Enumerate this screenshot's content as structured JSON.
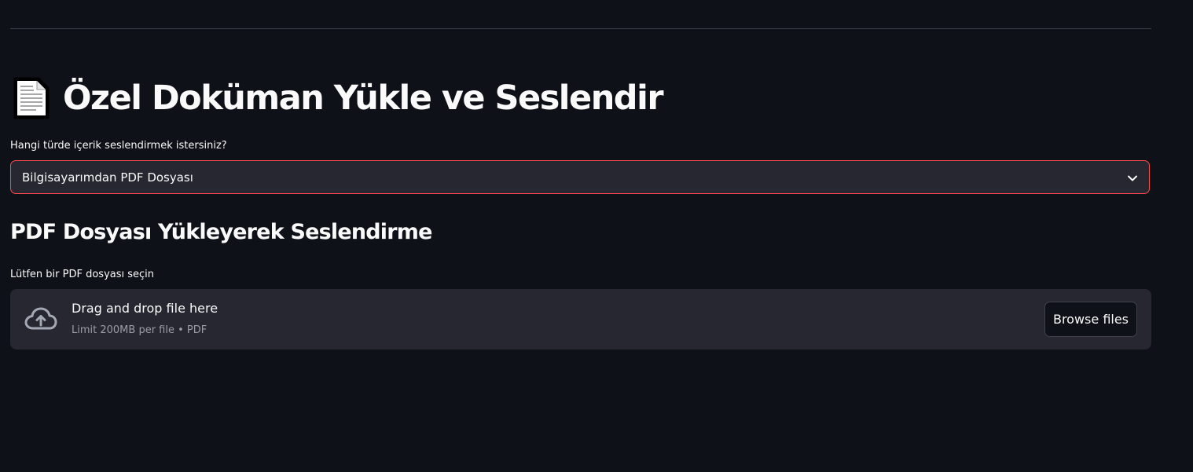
{
  "page": {
    "title": "Özel Doküman Yükle ve Seslendir",
    "title_icon": "page-facing-up-icon"
  },
  "content_type": {
    "label": "Hangi türde içerik seslendirmek istersiniz?",
    "selected": "Bilgisayarımdan PDF Dosyası",
    "accent_color": "#ff4b4b"
  },
  "section": {
    "title": "PDF Dosyası Yükleyerek Seslendirme"
  },
  "uploader": {
    "label": "Lütfen bir PDF dosyası seçin",
    "drop_text": "Drag and drop file here",
    "limit_text": "Limit 200MB per file • PDF",
    "browse_label": "Browse files",
    "icon": "cloud-upload-icon"
  },
  "colors": {
    "background": "#0e1117",
    "surface": "#262730",
    "text": "#fafafa",
    "muted": "#9a9ca6"
  }
}
